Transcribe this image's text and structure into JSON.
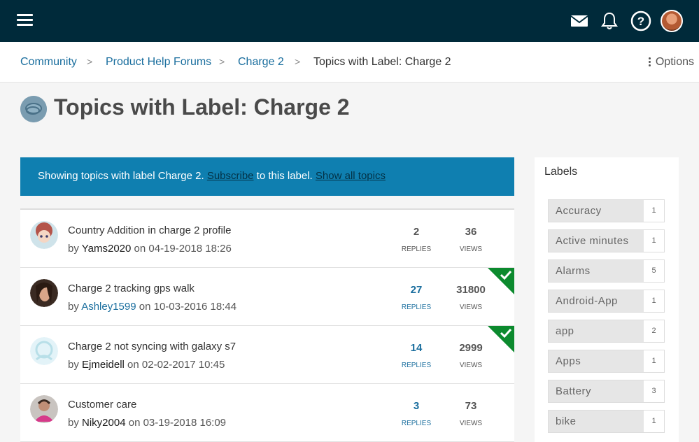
{
  "header": {
    "icons": [
      "menu-icon",
      "mail-icon",
      "bell-icon",
      "help-icon",
      "avatar"
    ]
  },
  "breadcrumb": {
    "items": [
      "Community",
      "Product Help Forums",
      "Charge 2"
    ],
    "current": "Topics with Label: Charge 2",
    "separator": ">",
    "options_label": "Options"
  },
  "page": {
    "title": "Topics with Label: Charge 2"
  },
  "banner": {
    "text_before": "Showing topics with label Charge 2. ",
    "subscribe_link": "Subscribe",
    "text_middle": " to this label. ",
    "show_all_link": "Show all topics"
  },
  "topics": [
    {
      "title": "Country Addition in charge 2 profile",
      "by": "by ",
      "author": "Yams2020",
      "on": " on ",
      "date": "04-19-2018 18:26",
      "replies": "2",
      "views": "36",
      "replies_label": "REPLIES",
      "views_label": "VIEWS",
      "solved": false
    },
    {
      "title": "Charge 2 tracking gps walk",
      "by": "by ",
      "author": "Ashley1599",
      "on": " on ",
      "date": "10-03-2016 18:44",
      "replies": "27",
      "views": "31800",
      "replies_label": "REPLIES",
      "views_label": "VIEWS",
      "solved": true
    },
    {
      "title": "Charge 2 not syncing with galaxy s7",
      "by": "by ",
      "author": "Ejmeidell",
      "on": " on ",
      "date": "02-02-2017 10:45",
      "replies": "14",
      "views": "2999",
      "replies_label": "REPLIES",
      "views_label": "VIEWS",
      "solved": true
    },
    {
      "title": "Customer care",
      "by": "by ",
      "author": "Niky2004",
      "on": " on ",
      "date": "03-19-2018 16:09",
      "replies": "3",
      "views": "73",
      "replies_label": "REPLIES",
      "views_label": "VIEWS",
      "solved": false
    }
  ],
  "labels": {
    "title": "Labels",
    "items": [
      {
        "name": "Accuracy",
        "count": "1"
      },
      {
        "name": "Active minutes",
        "count": "1"
      },
      {
        "name": "Alarms",
        "count": "5"
      },
      {
        "name": "Android-App",
        "count": "1"
      },
      {
        "name": "app",
        "count": "2"
      },
      {
        "name": "Apps",
        "count": "1"
      },
      {
        "name": "Battery",
        "count": "3"
      },
      {
        "name": "bike",
        "count": "1"
      }
    ]
  },
  "colors": {
    "header_bg": "#002a3a",
    "link": "#1a6e9e",
    "banner_bg": "#0f7fb0",
    "solved_badge": "#0c8a2e"
  }
}
